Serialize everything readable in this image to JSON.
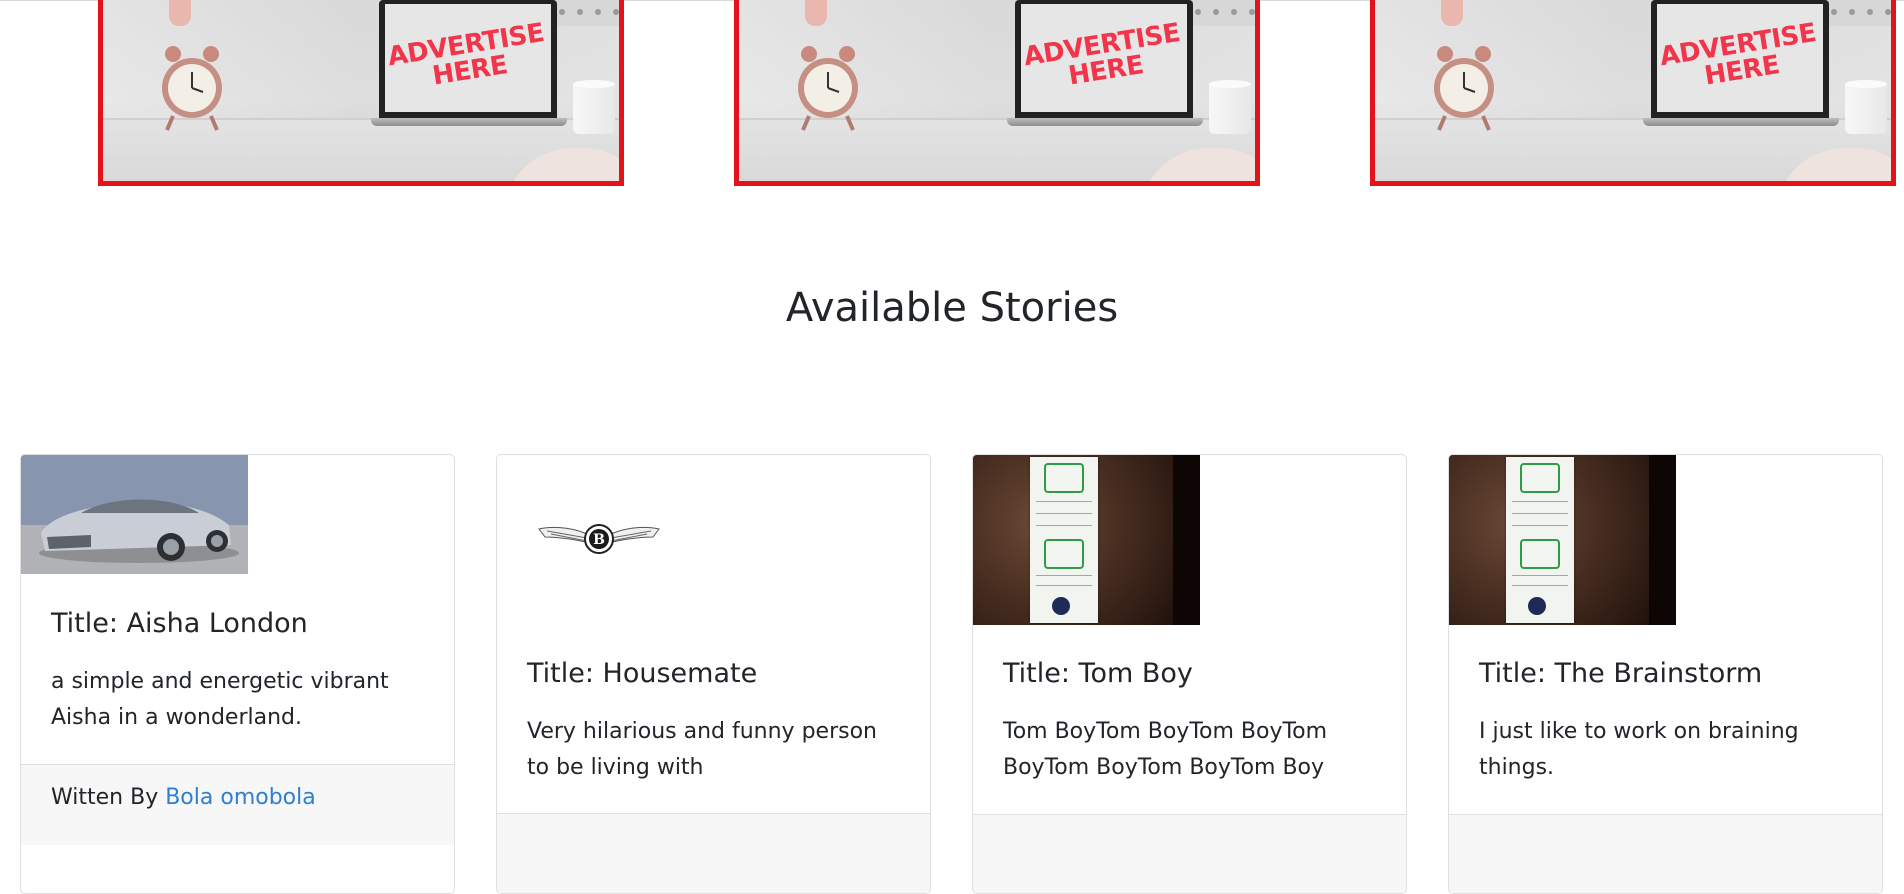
{
  "ads": [
    {
      "text_line1": "ADVERTISE",
      "text_line2": "HERE"
    },
    {
      "text_line1": "ADVERTISE",
      "text_line2": "HERE"
    },
    {
      "text_line1": "ADVERTISE",
      "text_line2": "HERE"
    }
  ],
  "section": {
    "title": "Available Stories"
  },
  "stories": [
    {
      "image": "car-photo",
      "title": "Title: Aisha London",
      "description": "a simple and energetic vibrant Aisha in a wonderland.",
      "author_prefix": "Witten By ",
      "author_name": "Bola omobola"
    },
    {
      "image": "bentley-logo",
      "title": "Title: Housemate",
      "description": "Very hilarious and funny person to be living with"
    },
    {
      "image": "check-photo",
      "title": "Title: Tom Boy",
      "description": "Tom BoyTom BoyTom BoyTom BoyTom BoyTom BoyTom Boy"
    },
    {
      "image": "check-photo",
      "title": "Title: The Brainstorm",
      "description": "I just like to work on braining things."
    }
  ],
  "colors": {
    "ad_border": "#e4131a",
    "ad_text": "#f2354a",
    "link": "#2f7fd1",
    "text": "#212529",
    "card_border": "#dfdfdf"
  }
}
